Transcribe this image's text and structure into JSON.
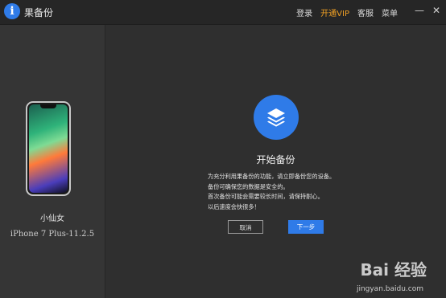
{
  "app": {
    "title": "果备份",
    "logo_glyph": "i"
  },
  "top_menu": {
    "login": "登录",
    "vip": "开通VIP",
    "service": "客服",
    "menu": "菜单"
  },
  "window_controls": {
    "minimize": "—",
    "close": "✕"
  },
  "device": {
    "name": "小仙女",
    "model": "iPhone 7 Plus-11.2.5"
  },
  "main": {
    "title": "开始备份",
    "desc_lines": [
      "为充分利用果备份的功能，请立即备份您的设备。",
      "备份可确保您的数据是安全的。",
      "首次备份可能会需要较长时间，请保持耐心。",
      "以后速度会快很多！"
    ],
    "cancel_label": "取消",
    "next_label": "下一步"
  },
  "watermark": {
    "text": "Bai 经验",
    "url": "jingyan.baidu.com"
  },
  "colors": {
    "accent": "#2f7be8",
    "vip": "#f0a024",
    "background": "#2f2f2f",
    "sidebar": "#353535"
  }
}
